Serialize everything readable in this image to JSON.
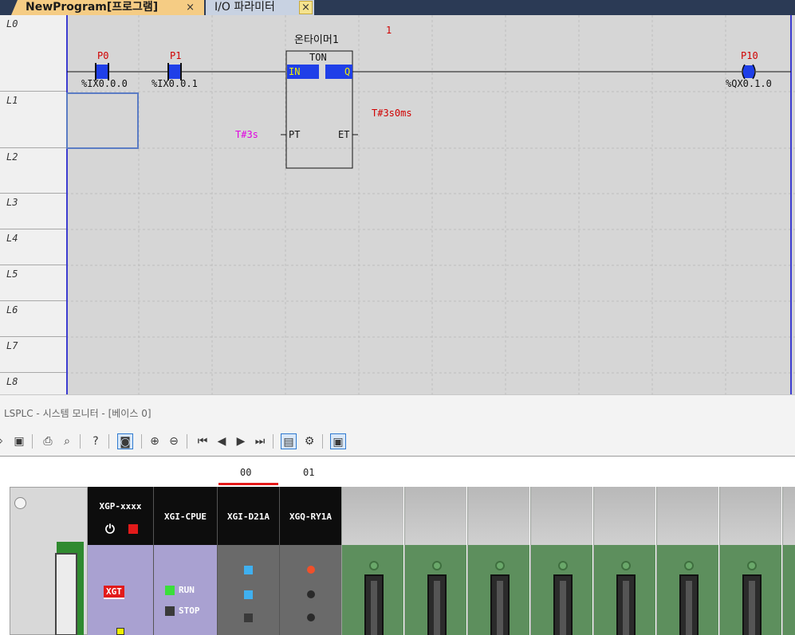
{
  "tabs": {
    "program_tab": "NewProgram[프로그램]",
    "io_tab": "I/O 파라미터",
    "close_symbol": "×"
  },
  "ladder": {
    "rows": [
      "L0",
      "L1",
      "L2",
      "L3",
      "L4",
      "L5",
      "L6",
      "L7",
      "L8"
    ],
    "rung_number": "1",
    "contacts": [
      {
        "name": "P0",
        "address": "%IX0.0.0"
      },
      {
        "name": "P1",
        "address": "%IX0.0.1"
      }
    ],
    "coil": {
      "name": "P10",
      "address": "%QX0.1.0"
    },
    "timer": {
      "instance": "온타이머1",
      "type": "TON",
      "in_pin": "IN",
      "q_pin": "Q",
      "pt_pin": "PT",
      "et_pin": "ET",
      "pt_value": "T#3s",
      "et_value": "T#3s0ms"
    }
  },
  "monitor": {
    "title": "LSPLC - 시스템 모니터 - [베이스 0]",
    "slot_numbers": [
      "00",
      "01"
    ],
    "modules": [
      {
        "name": "XGP-xxxx"
      },
      {
        "name": "XGI-CPUE"
      },
      {
        "name": "XGI-D21A"
      },
      {
        "name": "XGQ-RY1A"
      }
    ],
    "xgt_label": "XGT",
    "run_label": "RUN",
    "stop_label": "STOP"
  },
  "colors": {
    "tab_active": "#f5cc84",
    "ladder_bg": "#d6d6d6",
    "rail": "#3c3cd0",
    "label_red": "#d00000",
    "label_magenta": "#e000e0",
    "highlight_blue": "#1f3fe8"
  }
}
